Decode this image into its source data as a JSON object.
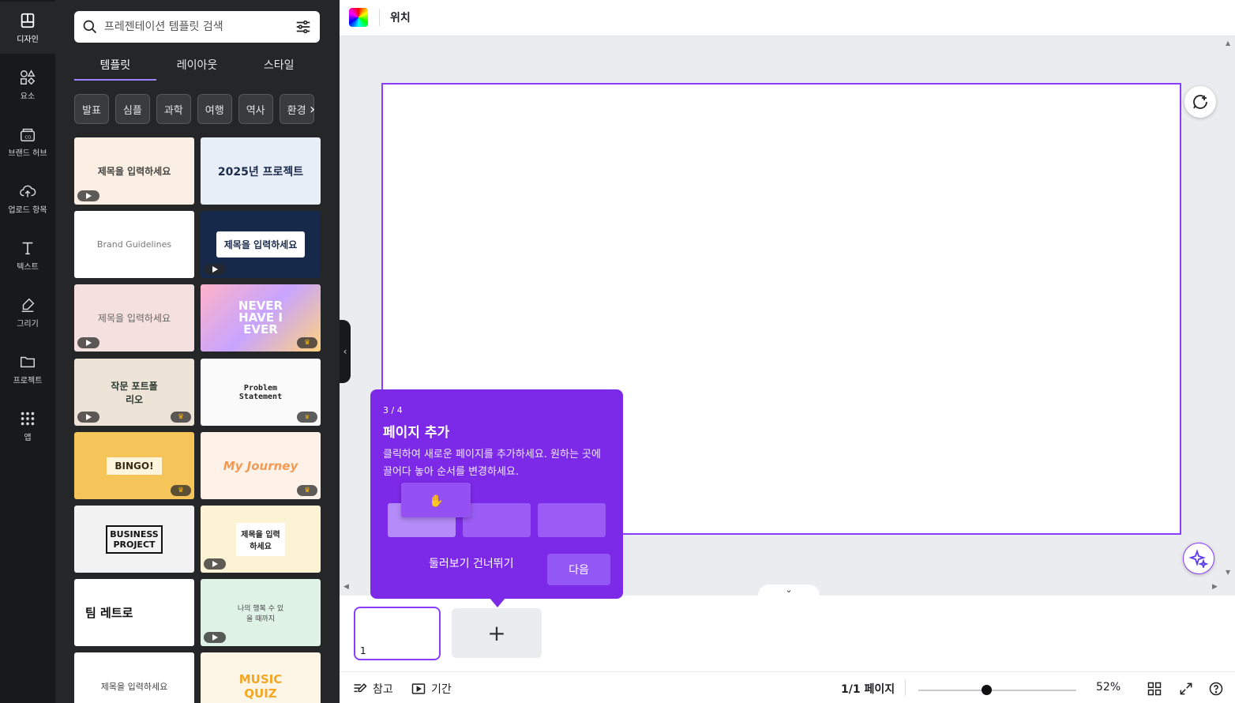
{
  "rail": {
    "items": [
      {
        "label": "디자인"
      },
      {
        "label": "요소"
      },
      {
        "label": "브랜드 허브"
      },
      {
        "label": "업로드 항목"
      },
      {
        "label": "텍스트"
      },
      {
        "label": "그리기"
      },
      {
        "label": "프로젝트"
      },
      {
        "label": "앱"
      }
    ]
  },
  "search": {
    "placeholder": "프레젠테이션 템플릿 검색"
  },
  "tabs": [
    {
      "label": "템플릿"
    },
    {
      "label": "레이아웃"
    },
    {
      "label": "스타일"
    }
  ],
  "chips": [
    "발표",
    "심플",
    "과학",
    "여행",
    "역사",
    "환경"
  ],
  "templates": [
    {
      "text": "제목을 입력하세요",
      "badge": "play"
    },
    {
      "text": "2025년 프로젝트",
      "badge": ""
    },
    {
      "text": "Brand Guidelines",
      "badge": ""
    },
    {
      "text": "제목을 입력하세요",
      "badge": "play"
    },
    {
      "text": "제목을 입력하세요",
      "badge": "play"
    },
    {
      "text": "NEVER HAVE I EVER",
      "badge": "crown"
    },
    {
      "text": "작문 포트폴리오",
      "badge": "both"
    },
    {
      "text": "Problem Statement",
      "badge": "crown"
    },
    {
      "text": "BINGO!",
      "badge": "crown"
    },
    {
      "text": "My Journey",
      "badge": "crown"
    },
    {
      "text": "BUSINESS PROJECT",
      "badge": ""
    },
    {
      "text": "제목을 입력하세요",
      "badge": "play"
    },
    {
      "text": "팀 레트로",
      "badge": ""
    },
    {
      "text": "나의 행복 수 있을 때까지",
      "badge": "play"
    },
    {
      "text": "제목을 입력하세요",
      "badge": ""
    },
    {
      "text": "MUSIC QUIZ",
      "badge": ""
    }
  ],
  "topbar": {
    "position_label": "위치"
  },
  "tooltip": {
    "step": "3 / 4",
    "title": "페이지 추가",
    "body": "클릭하여 새로운 페이지를 추가하세요. 원하는 곳에 끌어다 놓아 순서를 변경하세요.",
    "skip": "둘러보기 건너뛰기",
    "next": "다음"
  },
  "pages": {
    "page_number": "1",
    "add_symbol": "+"
  },
  "bottom": {
    "notes": "참고",
    "duration": "기간",
    "page_count": "1/1 페이지",
    "zoom": "52%",
    "zoom_fraction": 0.43
  },
  "colors": {
    "accent": "#8b3dff",
    "tooltip": "#7d2ae8",
    "rail": "#18191b",
    "panel": "#252627"
  }
}
